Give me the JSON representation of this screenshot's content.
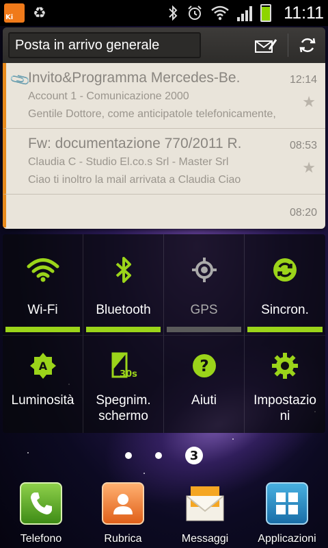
{
  "status_bar": {
    "time": "11:11",
    "kies_label": "Ki",
    "battery_level": 0.9
  },
  "email_widget": {
    "folder": "Posta in arrivo generale",
    "emails": [
      {
        "subject": "Invito&Programma  Mercedes-Be.",
        "sender": "Account 1 - Comunicazione 2000",
        "preview": "Gentile Dottore, come anticipatole telefonicamente,",
        "time": "12:14",
        "has_attachment": true
      },
      {
        "subject": "Fw: documentazione 770/2011 R.",
        "sender": "Claudia C - Studio El.co.s Srl - Master Srl",
        "preview": "Ciao ti inoltro la mail arrivata a Claudia Ciao",
        "time": "08:53",
        "has_attachment": false
      },
      {
        "time": "08:20"
      }
    ]
  },
  "quick_settings": {
    "wifi": {
      "label": "Wi-Fi",
      "on": true
    },
    "bluetooth": {
      "label": "Bluetooth",
      "on": true
    },
    "gps": {
      "label": "GPS",
      "on": false
    },
    "sync": {
      "label": "Sincron.",
      "on": true
    },
    "brightness": {
      "label": "Luminosità"
    },
    "screen_timeout": {
      "label": "Spegnim. schermo",
      "line1": "Spegnim.",
      "line2": "schermo",
      "badge": "30s"
    },
    "help": {
      "label": "Aiuti"
    },
    "settings": {
      "label": "Impostazioni",
      "line1": "Impostazio",
      "line2": "ni"
    }
  },
  "page_indicator": {
    "current": "3"
  },
  "dock": {
    "phone": "Telefono",
    "contacts": "Rubrica",
    "messages": "Messaggi",
    "apps": "Applicazioni"
  },
  "colors": {
    "accent_green": "#9bd41a",
    "email_stripe": "#e88a1c"
  }
}
